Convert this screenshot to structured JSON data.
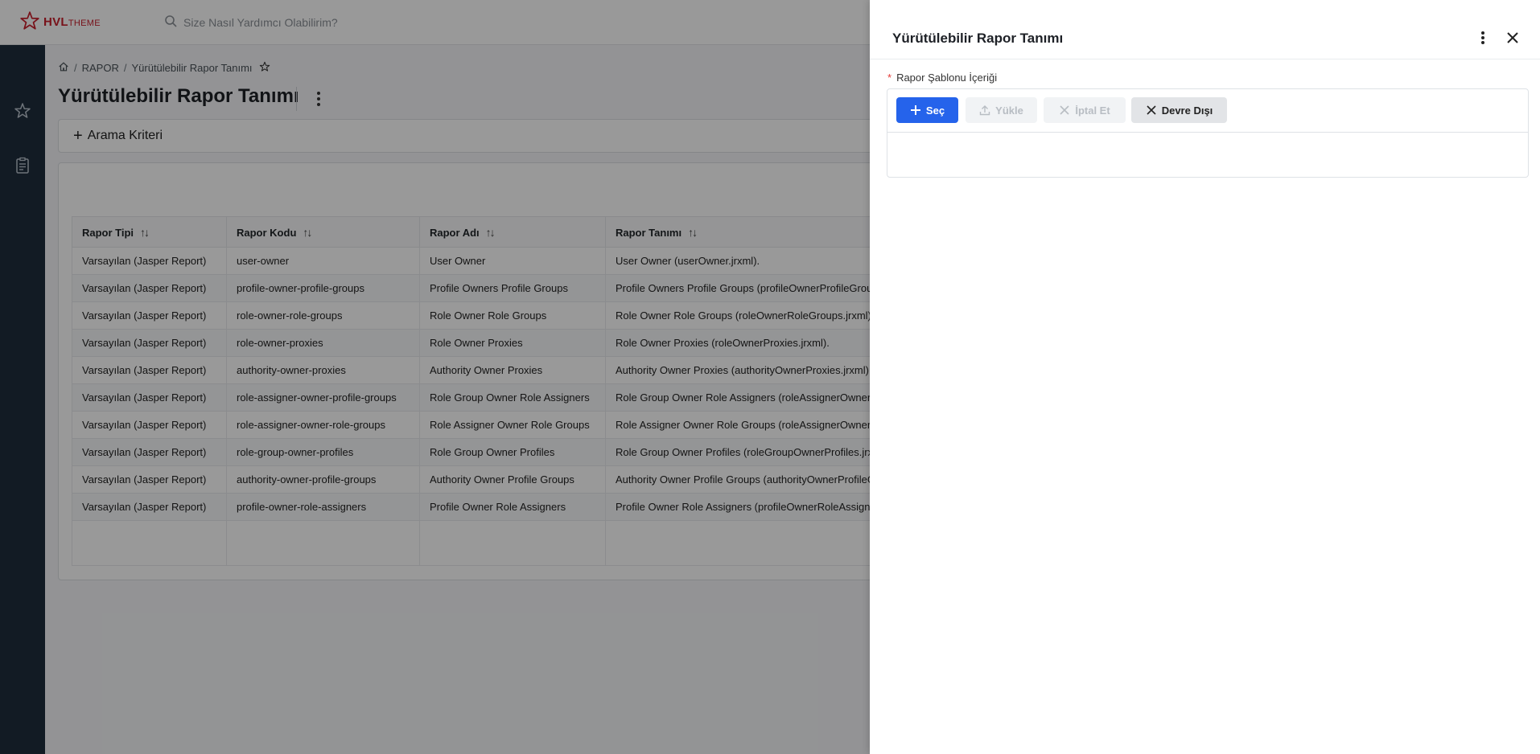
{
  "brand": {
    "name_bold": "HVL",
    "name_thin": "THEME",
    "color": "#c81e2c"
  },
  "search": {
    "placeholder": "Size Nasıl Yardımcı Olabilirim?"
  },
  "breadcrumb": {
    "module": "RAPOR",
    "page": "Yürütülebilir Rapor Tanımı"
  },
  "page": {
    "title": "Yürütülebilir Rapor Tanımı",
    "criteria_label": "Arama Kriteri"
  },
  "table": {
    "headers": [
      "Rapor Tipi",
      "Rapor Kodu",
      "Rapor Adı",
      "Rapor Tanımı"
    ],
    "rows": [
      [
        "Varsayılan (Jasper Report)",
        "user-owner",
        "User Owner",
        "User Owner (userOwner.jrxml)."
      ],
      [
        "Varsayılan (Jasper Report)",
        "profile-owner-profile-groups",
        "Profile Owners Profile Groups",
        "Profile Owners Profile Groups (profileOwnerProfileGroups"
      ],
      [
        "Varsayılan (Jasper Report)",
        "role-owner-role-groups",
        "Role Owner Role Groups",
        "Role Owner Role Groups (roleOwnerRoleGroups.jrxml)."
      ],
      [
        "Varsayılan (Jasper Report)",
        "role-owner-proxies",
        "Role Owner Proxies",
        "Role Owner Proxies (roleOwnerProxies.jrxml)."
      ],
      [
        "Varsayılan (Jasper Report)",
        "authority-owner-proxies",
        "Authority Owner Proxies",
        "Authority Owner Proxies (authorityOwnerProxies.jrxml)."
      ],
      [
        "Varsayılan (Jasper Report)",
        "role-assigner-owner-profile-groups",
        "Role Group Owner Role Assigners",
        "Role Group Owner Role Assigners (roleAssignerOwnerPro"
      ],
      [
        "Varsayılan (Jasper Report)",
        "role-assigner-owner-role-groups",
        "Role Assigner Owner Role Groups",
        "Role Assigner Owner Role Groups (roleAssignerOwnerRole"
      ],
      [
        "Varsayılan (Jasper Report)",
        "role-group-owner-profiles",
        "Role Group Owner Profiles",
        "Role Group Owner Profiles (roleGroupOwnerProfiles.jrxml"
      ],
      [
        "Varsayılan (Jasper Report)",
        "authority-owner-profile-groups",
        "Authority Owner Profile Groups",
        "Authority Owner Profile Groups (authorityOwnerProfileGr"
      ],
      [
        "Varsayılan (Jasper Report)",
        "profile-owner-role-assigners",
        "Profile Owner Role Assigners",
        "Profile Owner Role Assigners (profileOwnerRoleAssigners."
      ]
    ]
  },
  "drawer": {
    "title": "Yürütülebilir Rapor Tanımı",
    "field_label": "Rapor Şablonu İçeriği",
    "buttons": {
      "select": "Seç",
      "upload": "Yükle",
      "cancel": "İptal Et",
      "disable": "Devre Dışı"
    },
    "accent_color": "#2563eb"
  }
}
